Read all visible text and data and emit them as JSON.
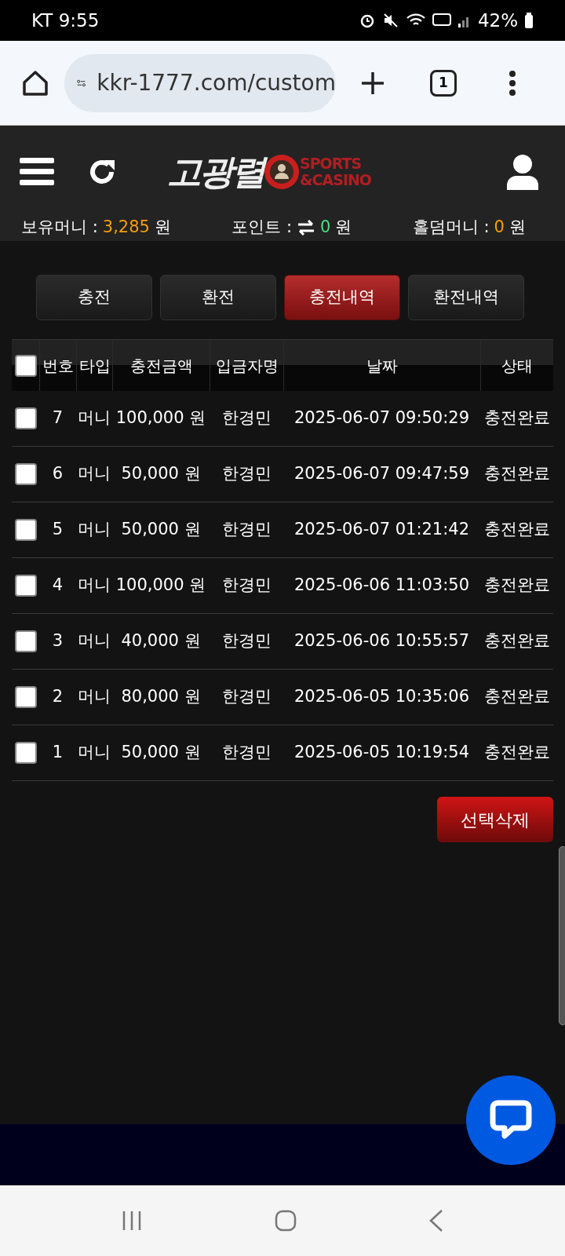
{
  "status_bar": {
    "carrier_time": "KT 9:55",
    "battery": "42%"
  },
  "browser": {
    "url": "kkr-1777.com/custom",
    "tab_count": "1"
  },
  "header": {
    "logo_text": "고광렬",
    "logo_sub": [
      "SPORTS",
      "&CASINO"
    ]
  },
  "balances": [
    {
      "label": "보유머니 :",
      "value": "3,285",
      "unit": "원",
      "color": "#f59e0b",
      "kind": "plain"
    },
    {
      "label": "포인트 :",
      "value": "0",
      "unit": "원",
      "color": "#4ade80",
      "kind": "exchange"
    },
    {
      "label": "홀덤머니 :",
      "value": "0",
      "unit": "원",
      "color": "#f59e0b",
      "kind": "plain"
    }
  ],
  "tabs": [
    {
      "label": "충전",
      "selected": false
    },
    {
      "label": "환전",
      "selected": false
    },
    {
      "label": "충전내역",
      "selected": true
    },
    {
      "label": "환전내역",
      "selected": false
    }
  ],
  "table": {
    "select_all": {
      "checked": false
    },
    "columns": [
      "번호",
      "타입",
      "충전금액",
      "입금자명",
      "날짜",
      "상태"
    ],
    "rows": [
      {
        "checked": false,
        "cells": [
          "7",
          "머니",
          "100,000 원",
          "한경민",
          "2025-06-07 09:50:29",
          "충전완료"
        ]
      },
      {
        "checked": false,
        "cells": [
          "6",
          "머니",
          "50,000 원",
          "한경민",
          "2025-06-07 09:47:59",
          "충전완료"
        ]
      },
      {
        "checked": false,
        "cells": [
          "5",
          "머니",
          "50,000 원",
          "한경민",
          "2025-06-07 01:21:42",
          "충전완료"
        ]
      },
      {
        "checked": false,
        "cells": [
          "4",
          "머니",
          "100,000 원",
          "한경민",
          "2025-06-06 11:03:50",
          "충전완료"
        ]
      },
      {
        "checked": false,
        "cells": [
          "3",
          "머니",
          "40,000 원",
          "한경민",
          "2025-06-06 10:55:57",
          "충전완료"
        ]
      },
      {
        "checked": false,
        "cells": [
          "2",
          "머니",
          "80,000 원",
          "한경민",
          "2025-06-05 10:35:06",
          "충전완료"
        ]
      },
      {
        "checked": false,
        "cells": [
          "1",
          "머니",
          "50,000 원",
          "한경민",
          "2025-06-05 10:19:54",
          "충전완료"
        ]
      }
    ]
  },
  "delete_button": "선택삭제"
}
